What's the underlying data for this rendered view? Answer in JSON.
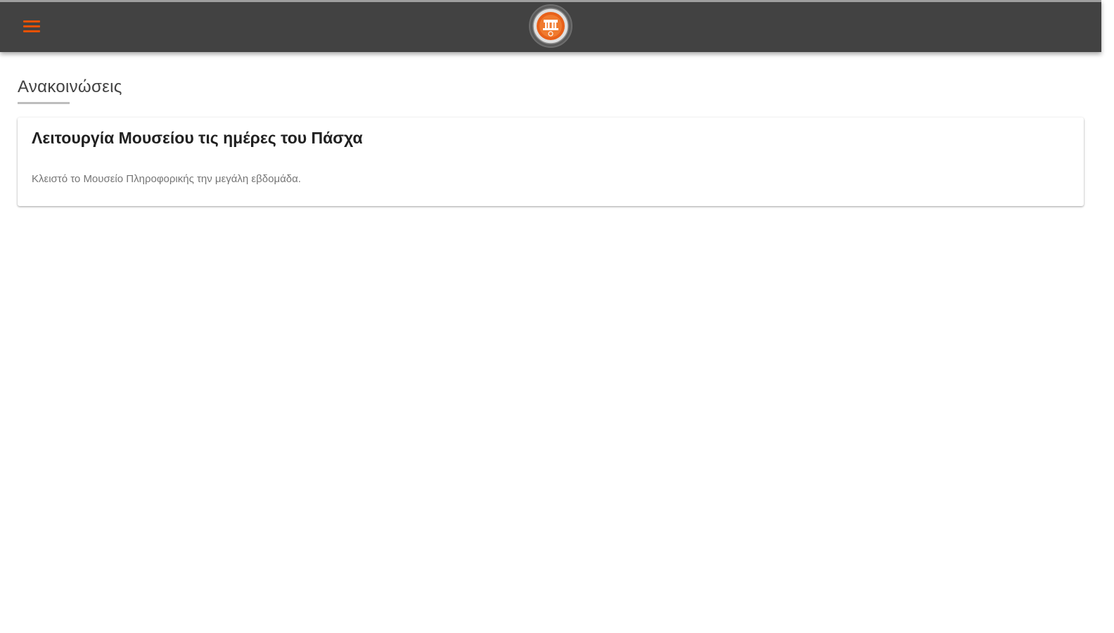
{
  "toolbar": {
    "menu_icon": "hamburger-menu-icon",
    "logo_icon": "museum-seal-logo",
    "background_color": "#424242",
    "accent_color": "#e65100"
  },
  "main": {
    "page_title": "Ανακοινώσεις",
    "announcements": [
      {
        "title": "Λειτουργία Μουσείου τις ημέρες του Πάσχα",
        "body": "Κλειστό το Μουσείο Πληροφορικής την μεγάλη εβδομάδα."
      }
    ]
  }
}
